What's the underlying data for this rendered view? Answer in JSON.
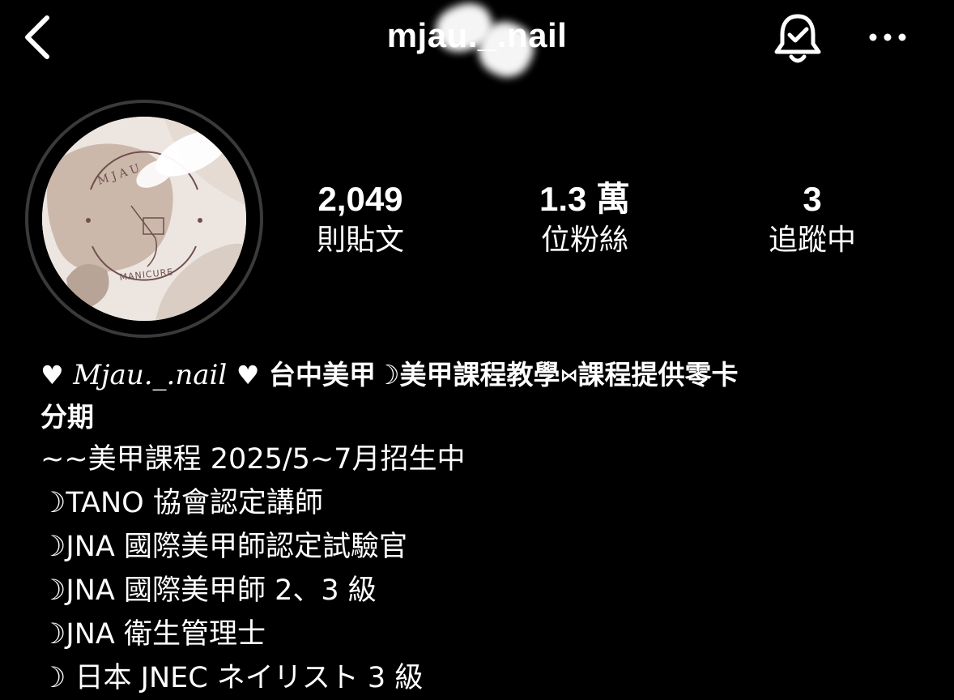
{
  "header": {
    "username": "mjau._.nail"
  },
  "icons": {
    "back": "chevron-left-icon",
    "notifications": "bell-check-icon",
    "more": "more-horizontal-icon"
  },
  "avatar": {
    "brand_text": "MJAU",
    "sub_text": "MANICURE"
  },
  "stats": {
    "posts": {
      "value": "2,049",
      "label": "則貼文"
    },
    "followers": {
      "value": "1.3 萬",
      "label": "位粉絲"
    },
    "following": {
      "value": "3",
      "label": "追蹤中"
    }
  },
  "bio": {
    "heart": "♥",
    "name_script": "Mjau._.nail",
    "tagline_part1": "台中美甲☽美甲課程教學",
    "bowtie": "⋈",
    "tagline_part2": "課程提供零卡",
    "tagline_wrap": "分期",
    "lines": [
      "~~美甲課程 2025/5~7月招生中",
      "☽TANO 協會認定講師",
      "☽JNA 國際美甲師認定試驗官",
      "☽JNA 國際美甲師 2、3 級",
      "☽JNA 衛生管理士",
      "☽ 日本 JNEC ネイリスト 3 級"
    ]
  }
}
